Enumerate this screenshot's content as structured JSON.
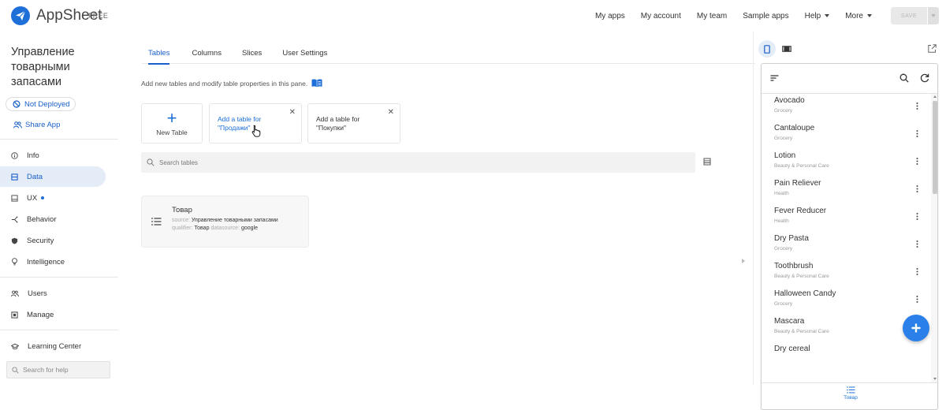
{
  "brand": {
    "name": "AppSheet",
    "badge": "FREE"
  },
  "topnav": {
    "items": [
      {
        "label": "My apps"
      },
      {
        "label": "My account"
      },
      {
        "label": "My team"
      },
      {
        "label": "Sample apps"
      },
      {
        "label": "Help"
      },
      {
        "label": "More"
      }
    ],
    "save_label": "SAVE"
  },
  "sidebar": {
    "app_title": "Управление товарными запасами",
    "deploy_status": "Not Deployed",
    "share_label": "Share App",
    "items": [
      {
        "label": "Info",
        "icon": "info-icon"
      },
      {
        "label": "Data",
        "icon": "data-icon",
        "active": true
      },
      {
        "label": "UX",
        "icon": "ux-icon",
        "dot": true
      },
      {
        "label": "Behavior",
        "icon": "behavior-icon"
      },
      {
        "label": "Security",
        "icon": "shield-icon"
      },
      {
        "label": "Intelligence",
        "icon": "lightbulb-icon"
      },
      {
        "label": "Users",
        "icon": "users-icon"
      },
      {
        "label": "Manage",
        "icon": "manage-icon"
      },
      {
        "label": "Learning Center",
        "icon": "graduation-cap-icon"
      }
    ],
    "help_search_placeholder": "Search for help"
  },
  "main": {
    "tabs": [
      {
        "label": "Tables",
        "active": true
      },
      {
        "label": "Columns"
      },
      {
        "label": "Slices"
      },
      {
        "label": "User Settings"
      }
    ],
    "description": "Add new tables and modify table properties in this pane.",
    "new_table_label": "New Table",
    "suggestions": [
      {
        "label": "Add a table for \"Продажи\""
      },
      {
        "label": "Add a table for \"Покупки\""
      }
    ],
    "search_placeholder": "Search tables",
    "table": {
      "name": "Товар",
      "source_key": "source:",
      "source_value": "Управление товарными запасами",
      "qualifier_key": "qualifier:",
      "qualifier_value": "Товар",
      "datasource_key": "datasource:",
      "datasource_value": "google"
    }
  },
  "preview": {
    "items": [
      {
        "name": "Avocado",
        "category": "Grocery"
      },
      {
        "name": "Cantaloupe",
        "category": "Grocery"
      },
      {
        "name": "Lotion",
        "category": "Beauty & Personal Care"
      },
      {
        "name": "Pain Reliever",
        "category": "Health"
      },
      {
        "name": "Fever Reducer",
        "category": "Health"
      },
      {
        "name": "Dry Pasta",
        "category": "Grocery"
      },
      {
        "name": "Toothbrush",
        "category": "Beauty & Personal Care"
      },
      {
        "name": "Halloween Candy",
        "category": "Grocery"
      },
      {
        "name": "Mascara",
        "category": "Beauty & Personal Care"
      },
      {
        "name": "Dry cereal",
        "category": ""
      }
    ],
    "nav_tab_label": "Товар"
  },
  "colors": {
    "accent": "#1a6fd8",
    "active_bg": "#e4ecf7",
    "fab": "#2a80e8"
  }
}
